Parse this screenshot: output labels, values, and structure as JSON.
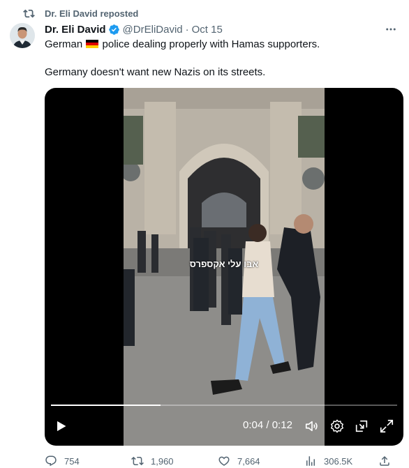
{
  "repost": {
    "label": "Dr. Eli David reposted",
    "icon": "repost-icon"
  },
  "tweet": {
    "author_name": "Dr. Eli David",
    "handle": "@DrEliDavid",
    "separator": "·",
    "date": "Oct 15",
    "verified": true,
    "text_line1_before_flag": "German",
    "text_line1_after_flag": "police dealing properly with Hamas supporters.",
    "flag_emoji": "german-flag",
    "text_line2": "Germany doesn't want new Nazis on its streets."
  },
  "video": {
    "overlay_caption": "אבו עלי אקספרס",
    "current_time": "0:04",
    "time_separator": " / ",
    "duration": "0:12",
    "progress_fraction": 0.317
  },
  "actions": {
    "replies": "754",
    "reposts": "1,960",
    "likes": "7,664",
    "views": "306.5K"
  },
  "colors": {
    "text_primary": "#0f1419",
    "text_secondary": "#536471",
    "verified": "#1d9bf0",
    "video_bg": "#000000"
  }
}
